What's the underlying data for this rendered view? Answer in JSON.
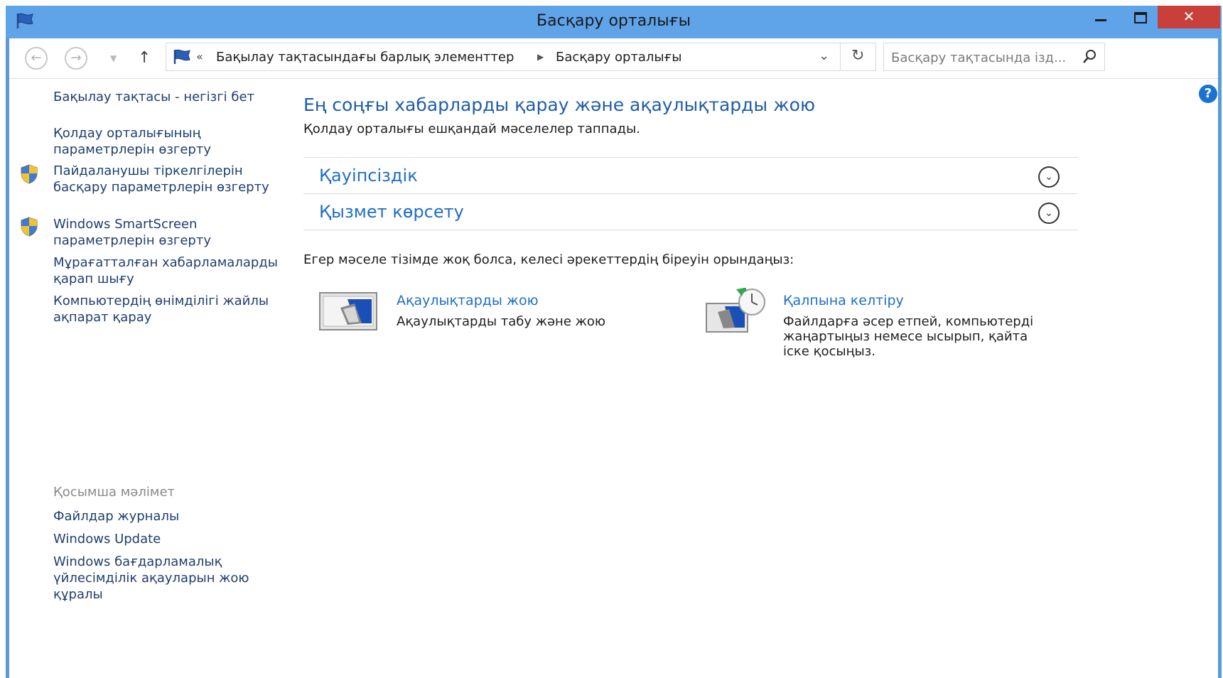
{
  "window": {
    "title": "Басқару орталығы",
    "close_glyph": "✕"
  },
  "nav": {
    "back_glyph": "←",
    "forward_glyph": "→",
    "recent_glyph": "▼",
    "up_glyph": "↑",
    "breadcrumb_overflow": "«",
    "breadcrumb": [
      "Бақылау тақтасындағы барлық элементтер",
      "Басқару орталығы"
    ],
    "breadcrumb_separator": "▶",
    "dropdown_glyph": "⌄",
    "refresh_glyph": "↻",
    "search_placeholder": "Басқару тақтасында ізд..."
  },
  "help": {
    "glyph": "?"
  },
  "sidebar": {
    "links": [
      "Бақылау тақтасы - негізгі бет",
      "Қолдау орталығының параметрлерін өзгерту",
      "Пайдаланушы тіркелгілерін басқару параметрлерін өзгерту",
      "Windows SmartScreen параметрлерін өзгерту",
      "Мұрағатталған хабарламаларды қарап шығу",
      "Компьютердің өнімділігі жайлы ақпарат қарау"
    ],
    "see_also_label": "Қосымша мәлімет",
    "see_also": [
      "Файлдар журналы",
      "Windows Update",
      "Windows  бағдарламалық үйлесімділік ақауларын жою құралы"
    ]
  },
  "main": {
    "heading": "Ең соңғы хабарларды қарау және ақаулықтарды жою",
    "subtitle": "Қолдау орталығы ешқандай мәселелер таппады.",
    "sections": [
      "Қауіпсіздік",
      "Қызмет көрсету"
    ],
    "expand_glyph": "⌄",
    "prompt": "Егер мәселе тізімде жоқ болса, келесі әрекеттердің біреуін орындаңыз:",
    "tasks": [
      {
        "title": "Ақаулықтарды жою",
        "description": "Ақаулықтарды табу және жою"
      },
      {
        "title": "Қалпына келтіру",
        "description": "Файлдарға әсер етпей, компьютерді жаңартыңыз немесе ысырып, қайта іске қосыңыз."
      }
    ]
  }
}
